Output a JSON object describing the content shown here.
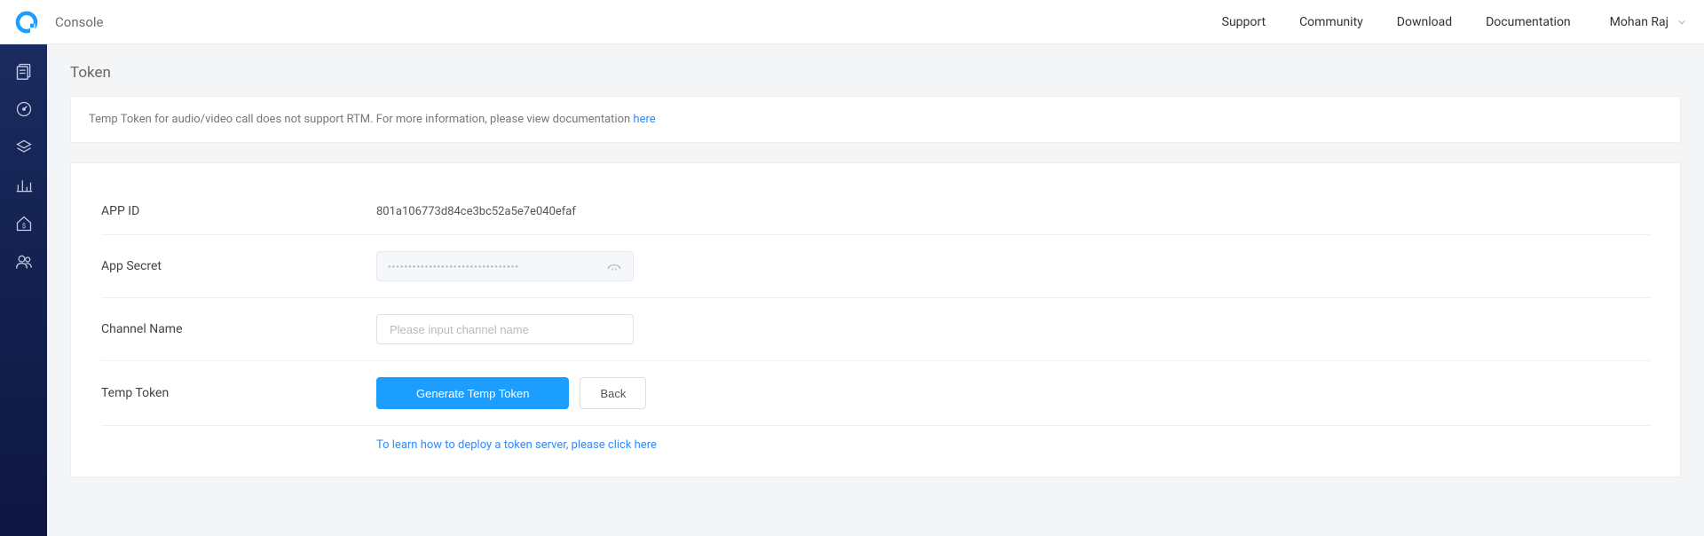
{
  "header": {
    "console_label": "Console",
    "nav": {
      "support": "Support",
      "community": "Community",
      "download": "Download",
      "documentation": "Documentation"
    },
    "user_name": "Mohan Raj"
  },
  "page": {
    "title": "Token",
    "banner_text": "Temp Token for audio/video call does not support RTM. For more information, please view documentation ",
    "banner_link": "here"
  },
  "form": {
    "app_id_label": "APP ID",
    "app_id_value": "801a106773d84ce3bc52a5e7e040efaf",
    "app_secret_label": "App Secret",
    "app_secret_mask": "●●●●●●●●●●●●●●●●●●●●●●●●●●●●●●●●",
    "channel_name_label": "Channel Name",
    "channel_name_placeholder": "Please input channel name",
    "temp_token_label": "Temp Token",
    "generate_button": "Generate Temp Token",
    "back_button": "Back",
    "help_link": "To learn how to deploy a token server, please click here"
  }
}
